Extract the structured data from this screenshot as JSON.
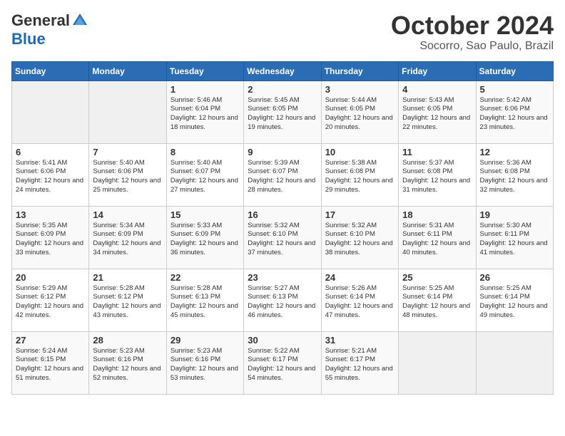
{
  "header": {
    "logo_general": "General",
    "logo_blue": "Blue",
    "month_title": "October 2024",
    "location": "Socorro, Sao Paulo, Brazil"
  },
  "days_of_week": [
    "Sunday",
    "Monday",
    "Tuesday",
    "Wednesday",
    "Thursday",
    "Friday",
    "Saturday"
  ],
  "weeks": [
    [
      {
        "day": "",
        "empty": true
      },
      {
        "day": "",
        "empty": true
      },
      {
        "day": "1",
        "sunrise": "Sunrise: 5:46 AM",
        "sunset": "Sunset: 6:04 PM",
        "daylight": "Daylight: 12 hours and 18 minutes."
      },
      {
        "day": "2",
        "sunrise": "Sunrise: 5:45 AM",
        "sunset": "Sunset: 6:05 PM",
        "daylight": "Daylight: 12 hours and 19 minutes."
      },
      {
        "day": "3",
        "sunrise": "Sunrise: 5:44 AM",
        "sunset": "Sunset: 6:05 PM",
        "daylight": "Daylight: 12 hours and 20 minutes."
      },
      {
        "day": "4",
        "sunrise": "Sunrise: 5:43 AM",
        "sunset": "Sunset: 6:05 PM",
        "daylight": "Daylight: 12 hours and 22 minutes."
      },
      {
        "day": "5",
        "sunrise": "Sunrise: 5:42 AM",
        "sunset": "Sunset: 6:06 PM",
        "daylight": "Daylight: 12 hours and 23 minutes."
      }
    ],
    [
      {
        "day": "6",
        "sunrise": "Sunrise: 5:41 AM",
        "sunset": "Sunset: 6:06 PM",
        "daylight": "Daylight: 12 hours and 24 minutes."
      },
      {
        "day": "7",
        "sunrise": "Sunrise: 5:40 AM",
        "sunset": "Sunset: 6:06 PM",
        "daylight": "Daylight: 12 hours and 25 minutes."
      },
      {
        "day": "8",
        "sunrise": "Sunrise: 5:40 AM",
        "sunset": "Sunset: 6:07 PM",
        "daylight": "Daylight: 12 hours and 27 minutes."
      },
      {
        "day": "9",
        "sunrise": "Sunrise: 5:39 AM",
        "sunset": "Sunset: 6:07 PM",
        "daylight": "Daylight: 12 hours and 28 minutes."
      },
      {
        "day": "10",
        "sunrise": "Sunrise: 5:38 AM",
        "sunset": "Sunset: 6:08 PM",
        "daylight": "Daylight: 12 hours and 29 minutes."
      },
      {
        "day": "11",
        "sunrise": "Sunrise: 5:37 AM",
        "sunset": "Sunset: 6:08 PM",
        "daylight": "Daylight: 12 hours and 31 minutes."
      },
      {
        "day": "12",
        "sunrise": "Sunrise: 5:36 AM",
        "sunset": "Sunset: 6:08 PM",
        "daylight": "Daylight: 12 hours and 32 minutes."
      }
    ],
    [
      {
        "day": "13",
        "sunrise": "Sunrise: 5:35 AM",
        "sunset": "Sunset: 6:09 PM",
        "daylight": "Daylight: 12 hours and 33 minutes."
      },
      {
        "day": "14",
        "sunrise": "Sunrise: 5:34 AM",
        "sunset": "Sunset: 6:09 PM",
        "daylight": "Daylight: 12 hours and 34 minutes."
      },
      {
        "day": "15",
        "sunrise": "Sunrise: 5:33 AM",
        "sunset": "Sunset: 6:09 PM",
        "daylight": "Daylight: 12 hours and 36 minutes."
      },
      {
        "day": "16",
        "sunrise": "Sunrise: 5:32 AM",
        "sunset": "Sunset: 6:10 PM",
        "daylight": "Daylight: 12 hours and 37 minutes."
      },
      {
        "day": "17",
        "sunrise": "Sunrise: 5:32 AM",
        "sunset": "Sunset: 6:10 PM",
        "daylight": "Daylight: 12 hours and 38 minutes."
      },
      {
        "day": "18",
        "sunrise": "Sunrise: 5:31 AM",
        "sunset": "Sunset: 6:11 PM",
        "daylight": "Daylight: 12 hours and 40 minutes."
      },
      {
        "day": "19",
        "sunrise": "Sunrise: 5:30 AM",
        "sunset": "Sunset: 6:11 PM",
        "daylight": "Daylight: 12 hours and 41 minutes."
      }
    ],
    [
      {
        "day": "20",
        "sunrise": "Sunrise: 5:29 AM",
        "sunset": "Sunset: 6:12 PM",
        "daylight": "Daylight: 12 hours and 42 minutes."
      },
      {
        "day": "21",
        "sunrise": "Sunrise: 5:28 AM",
        "sunset": "Sunset: 6:12 PM",
        "daylight": "Daylight: 12 hours and 43 minutes."
      },
      {
        "day": "22",
        "sunrise": "Sunrise: 5:28 AM",
        "sunset": "Sunset: 6:13 PM",
        "daylight": "Daylight: 12 hours and 45 minutes."
      },
      {
        "day": "23",
        "sunrise": "Sunrise: 5:27 AM",
        "sunset": "Sunset: 6:13 PM",
        "daylight": "Daylight: 12 hours and 46 minutes."
      },
      {
        "day": "24",
        "sunrise": "Sunrise: 5:26 AM",
        "sunset": "Sunset: 6:14 PM",
        "daylight": "Daylight: 12 hours and 47 minutes."
      },
      {
        "day": "25",
        "sunrise": "Sunrise: 5:25 AM",
        "sunset": "Sunset: 6:14 PM",
        "daylight": "Daylight: 12 hours and 48 minutes."
      },
      {
        "day": "26",
        "sunrise": "Sunrise: 5:25 AM",
        "sunset": "Sunset: 6:14 PM",
        "daylight": "Daylight: 12 hours and 49 minutes."
      }
    ],
    [
      {
        "day": "27",
        "sunrise": "Sunrise: 5:24 AM",
        "sunset": "Sunset: 6:15 PM",
        "daylight": "Daylight: 12 hours and 51 minutes."
      },
      {
        "day": "28",
        "sunrise": "Sunrise: 5:23 AM",
        "sunset": "Sunset: 6:16 PM",
        "daylight": "Daylight: 12 hours and 52 minutes."
      },
      {
        "day": "29",
        "sunrise": "Sunrise: 5:23 AM",
        "sunset": "Sunset: 6:16 PM",
        "daylight": "Daylight: 12 hours and 53 minutes."
      },
      {
        "day": "30",
        "sunrise": "Sunrise: 5:22 AM",
        "sunset": "Sunset: 6:17 PM",
        "daylight": "Daylight: 12 hours and 54 minutes."
      },
      {
        "day": "31",
        "sunrise": "Sunrise: 5:21 AM",
        "sunset": "Sunset: 6:17 PM",
        "daylight": "Daylight: 12 hours and 55 minutes."
      },
      {
        "day": "",
        "empty": true
      },
      {
        "day": "",
        "empty": true
      }
    ]
  ]
}
